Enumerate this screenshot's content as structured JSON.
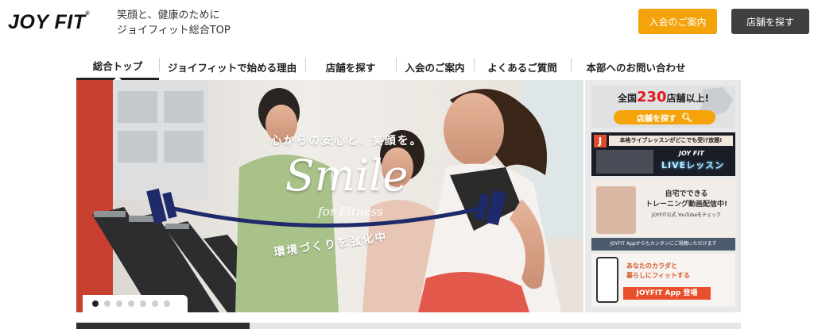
{
  "header": {
    "logo_text": "JOY FIT",
    "logo_mark": "®",
    "tagline_line1": "笑顔と、健康のために",
    "tagline_line2": "ジョイフィット総合TOP",
    "join_button_label": "入会のご案内",
    "store_button_label": "店舗を探す",
    "accent_color": "#f4a30b",
    "dark_color": "#404040"
  },
  "nav": {
    "items": [
      {
        "label": "総合トップ",
        "active": true
      },
      {
        "label": "ジョイフィットで始める理由",
        "active": false
      },
      {
        "label": "店舗を探す",
        "active": false
      },
      {
        "label": "入会のご案内",
        "active": false
      },
      {
        "label": "よくあるご質問",
        "active": false
      },
      {
        "label": "本部へのお問い合わせ",
        "active": false
      }
    ]
  },
  "hero": {
    "headline": "心からの安心と、笑顔を。",
    "main_word": "Smile",
    "sub_word": "for Fitness",
    "caption": "環境づくりを強化中",
    "slide_count": 7,
    "active_slide": 1
  },
  "side_banners": {
    "stores": {
      "line1_prefix": "全国",
      "number": "230",
      "line1_suffix": "店舗以上!",
      "button": "店舗を探す",
      "icon": "search-icon"
    },
    "live": {
      "badge": "J",
      "ribbon": "本格ライブレッスンがどこでも受け放題!",
      "brand": "JOY FIT",
      "name": "LIVEレッスン"
    },
    "video": {
      "line1": "自宅でできる",
      "line2": "トレーニング動画配信中!",
      "line3": "JOYFIT公式 YouTubeをチェック",
      "footer": "JOYFIT Appからもカンタンにご視聴いただけます"
    },
    "app": {
      "line1": "あなたのカラダと",
      "line2": "暮らしにフィットする",
      "button": "JOYFIT App 登場"
    }
  }
}
